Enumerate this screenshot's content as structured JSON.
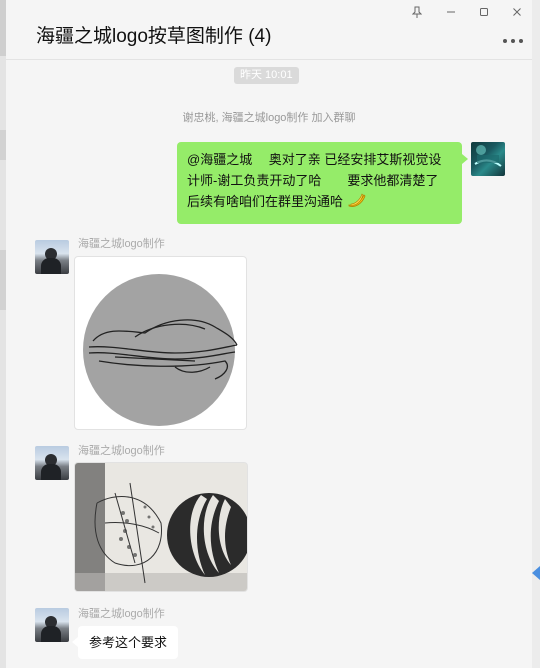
{
  "window": {
    "title": "海疆之城logo按草图制作 (4)",
    "controls": {
      "pin": "pin-icon",
      "minimize": "minimize-icon",
      "maximize": "maximize-icon",
      "close": "close-icon"
    },
    "more": "more-icon"
  },
  "chat": {
    "time": "昨天 10:01",
    "system_message": "谢忠桃, 海疆之城logo制作 加入群聊",
    "self_message": {
      "avatar": "self-avatar",
      "text": "@海疆之城　 奥对了亲 已经安排艾斯视觉设计师-谢工负责开动了哈　　要求他都清楚了　后续有啥咱们在群里沟通哈",
      "emoji": "banana-icon"
    },
    "messages": [
      {
        "sender": "海疆之城logo制作",
        "type": "image",
        "description": "sketch-boat-circle"
      },
      {
        "sender": "海疆之城logo制作",
        "type": "image",
        "description": "sketch-paper-photo"
      },
      {
        "sender": "海疆之城logo制作",
        "type": "text",
        "text": "参考这个要求"
      }
    ]
  },
  "colors": {
    "self_bubble": "#95ec69",
    "background": "#f5f5f5",
    "other_bubble": "#ffffff"
  }
}
